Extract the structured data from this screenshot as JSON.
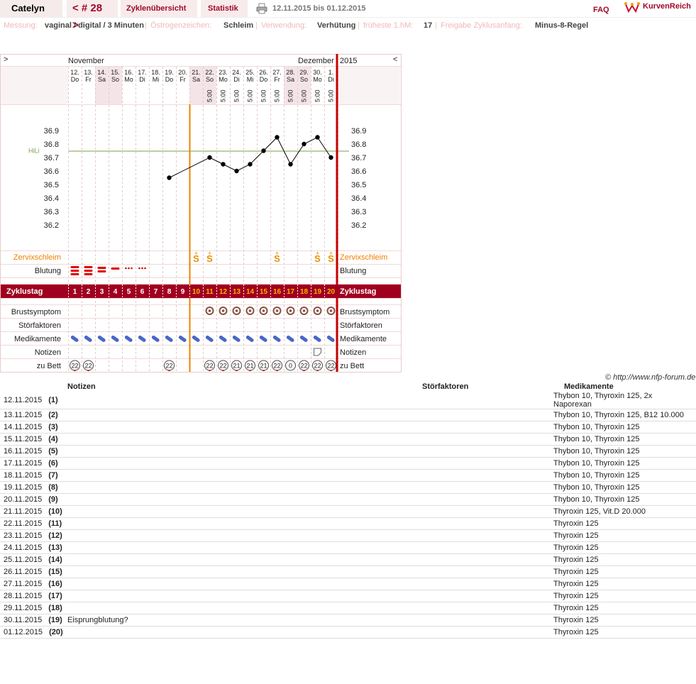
{
  "header": {
    "user": "Catelyn",
    "cycle_nav": "< # 28 >",
    "tab_overview": "Zyklenübersicht",
    "tab_stats": "Statistik",
    "date_range": "12.11.2015 bis 01.12.2015",
    "faq": "FAQ",
    "logo": "KurvenReich"
  },
  "info": {
    "messung_label": "Messung:",
    "messung_value": "vaginal / digital / 3 Minuten",
    "oestrogen_label": "Östrogenzeichen:",
    "oestrogen_value": "Schleim",
    "verwendung_label": "Verwendung:",
    "verwendung_value": "Verhütung",
    "fhm_label": "früheste 1.hM:",
    "fhm_value": "17",
    "freigabe_label": "Freigabe Zyklusanfang:",
    "freigabe_value": "Minus-8-Regel"
  },
  "chart_data": {
    "type": "line",
    "months": {
      "left": "November",
      "right": "Dezember",
      "year": "2015"
    },
    "nav": {
      "prev": ">",
      "next": "<"
    },
    "days": [
      {
        "date": "12.",
        "wd": "Do"
      },
      {
        "date": "13.",
        "wd": "Fr"
      },
      {
        "date": "14.",
        "wd": "Sa"
      },
      {
        "date": "15.",
        "wd": "So"
      },
      {
        "date": "16.",
        "wd": "Mo"
      },
      {
        "date": "17.",
        "wd": "Di"
      },
      {
        "date": "18.",
        "wd": "Mi"
      },
      {
        "date": "19.",
        "wd": "Do"
      },
      {
        "date": "20.",
        "wd": "Fr"
      },
      {
        "date": "21.",
        "wd": "Sa"
      },
      {
        "date": "22.",
        "wd": "So"
      },
      {
        "date": "23.",
        "wd": "Mo"
      },
      {
        "date": "24.",
        "wd": "Di"
      },
      {
        "date": "25.",
        "wd": "Mi"
      },
      {
        "date": "26.",
        "wd": "Do"
      },
      {
        "date": "27.",
        "wd": "Fr"
      },
      {
        "date": "28.",
        "wd": "Sa"
      },
      {
        "date": "29.",
        "wd": "So"
      },
      {
        "date": "30.",
        "wd": "Mo"
      },
      {
        "date": "1.",
        "wd": "Di"
      }
    ],
    "weekend_days": [
      3,
      4,
      10,
      11,
      17,
      18
    ],
    "times": [
      "",
      "",
      "",
      "",
      "",
      "",
      "",
      "",
      "",
      "",
      "5:00",
      "5:00",
      "5:00",
      "5:00",
      "5:00",
      "5:00",
      "5:00",
      "5:00",
      "5:00",
      "5:00"
    ],
    "y_ticks": [
      "36.9",
      "36.8",
      "36.7",
      "36.6",
      "36.5",
      "36.4",
      "36.3",
      "36.2"
    ],
    "ylim": [
      36.2,
      36.9
    ],
    "hili_label": "HiLi",
    "hili_value": 36.75,
    "temps": [
      null,
      null,
      null,
      null,
      null,
      null,
      null,
      36.55,
      null,
      null,
      36.7,
      36.65,
      36.6,
      36.65,
      36.75,
      36.85,
      36.65,
      36.8,
      36.85,
      36.7
    ],
    "row_labels": {
      "zervix": "Zervixschleim",
      "blutung": "Blutung",
      "zyklustag": "Zyklustag",
      "brust": "Brustsymptom",
      "stoer": "Störfaktoren",
      "medi": "Medikamente",
      "notizen": "Notizen",
      "bett": "zu Bett"
    },
    "zervix": [
      "",
      "",
      "",
      "",
      "",
      "",
      "",
      "",
      "",
      "S+",
      "S+",
      "",
      "",
      "",
      "",
      "S+",
      "",
      "",
      "S+",
      "S+"
    ],
    "blutung": [
      3,
      3,
      2,
      1,
      "s",
      "s",
      "",
      "",
      "",
      "",
      "",
      "",
      "",
      "",
      "",
      "",
      "",
      "",
      "",
      ""
    ],
    "cycle_days": [
      "1",
      "2",
      "3",
      "4",
      "5",
      "6",
      "7",
      "8",
      "9",
      "10",
      "11",
      "12",
      "13",
      "14",
      "15",
      "16",
      "17",
      "18",
      "19",
      "20"
    ],
    "brust": [
      false,
      false,
      false,
      false,
      false,
      false,
      false,
      false,
      false,
      false,
      true,
      true,
      true,
      true,
      true,
      true,
      true,
      true,
      true,
      true
    ],
    "medikamente": [
      true,
      true,
      true,
      true,
      true,
      true,
      true,
      true,
      true,
      true,
      true,
      true,
      true,
      true,
      true,
      true,
      true,
      true,
      true,
      true
    ],
    "notizen": [
      false,
      false,
      false,
      false,
      false,
      false,
      false,
      false,
      false,
      false,
      false,
      false,
      false,
      false,
      false,
      false,
      false,
      false,
      true,
      false
    ],
    "bett": [
      "22",
      "22",
      "",
      "",
      "",
      "",
      "",
      "22",
      "",
      "",
      "22",
      "22",
      "21",
      "21",
      "21",
      "22",
      "0",
      "22",
      "22",
      "22"
    ]
  },
  "copyright": "© http://www.nfp-forum.de",
  "table": {
    "headers": {
      "notizen": "Notizen",
      "stoer": "Störfaktoren",
      "medi": "Medikamente"
    },
    "rows": [
      {
        "date": "12.11.2015",
        "day": "(1)",
        "note": "",
        "stoer": "",
        "medi": "Thybon 10, Thyroxin 125, 2x Naporexan"
      },
      {
        "date": "13.11.2015",
        "day": "(2)",
        "note": "",
        "stoer": "",
        "medi": "Thybon 10, Thyroxin 125, B12 10.000"
      },
      {
        "date": "14.11.2015",
        "day": "(3)",
        "note": "",
        "stoer": "",
        "medi": "Thybon 10, Thyroxin 125"
      },
      {
        "date": "15.11.2015",
        "day": "(4)",
        "note": "",
        "stoer": "",
        "medi": "Thybon 10, Thyroxin 125"
      },
      {
        "date": "16.11.2015",
        "day": "(5)",
        "note": "",
        "stoer": "",
        "medi": "Thybon 10, Thyroxin 125"
      },
      {
        "date": "17.11.2015",
        "day": "(6)",
        "note": "",
        "stoer": "",
        "medi": "Thybon 10, Thyroxin 125"
      },
      {
        "date": "18.11.2015",
        "day": "(7)",
        "note": "",
        "stoer": "",
        "medi": "Thybon 10, Thyroxin 125"
      },
      {
        "date": "19.11.2015",
        "day": "(8)",
        "note": "",
        "stoer": "",
        "medi": "Thybon 10, Thyroxin 125"
      },
      {
        "date": "20.11.2015",
        "day": "(9)",
        "note": "",
        "stoer": "",
        "medi": "Thybon 10, Thyroxin 125"
      },
      {
        "date": "21.11.2015",
        "day": "(10)",
        "note": "",
        "stoer": "",
        "medi": "Thyroxin 125, Vit.D 20.000"
      },
      {
        "date": "22.11.2015",
        "day": "(11)",
        "note": "",
        "stoer": "",
        "medi": "Thyroxin 125"
      },
      {
        "date": "23.11.2015",
        "day": "(12)",
        "note": "",
        "stoer": "",
        "medi": "Thyroxin 125"
      },
      {
        "date": "24.11.2015",
        "day": "(13)",
        "note": "",
        "stoer": "",
        "medi": "Thyroxin 125"
      },
      {
        "date": "25.11.2015",
        "day": "(14)",
        "note": "",
        "stoer": "",
        "medi": "Thyroxin 125"
      },
      {
        "date": "26.11.2015",
        "day": "(15)",
        "note": "",
        "stoer": "",
        "medi": "Thyroxin 125"
      },
      {
        "date": "27.11.2015",
        "day": "(16)",
        "note": "",
        "stoer": "",
        "medi": "Thyroxin 125"
      },
      {
        "date": "28.11.2015",
        "day": "(17)",
        "note": "",
        "stoer": "",
        "medi": "Thyroxin 125"
      },
      {
        "date": "29.11.2015",
        "day": "(18)",
        "note": "",
        "stoer": "",
        "medi": "Thyroxin 125"
      },
      {
        "date": "30.11.2015",
        "day": "(19)",
        "note": "Eisprungblutung?",
        "stoer": "",
        "medi": "Thyroxin 125"
      },
      {
        "date": "01.12.2015",
        "day": "(20)",
        "note": "",
        "stoer": "",
        "medi": "Thyroxin 125"
      }
    ]
  }
}
